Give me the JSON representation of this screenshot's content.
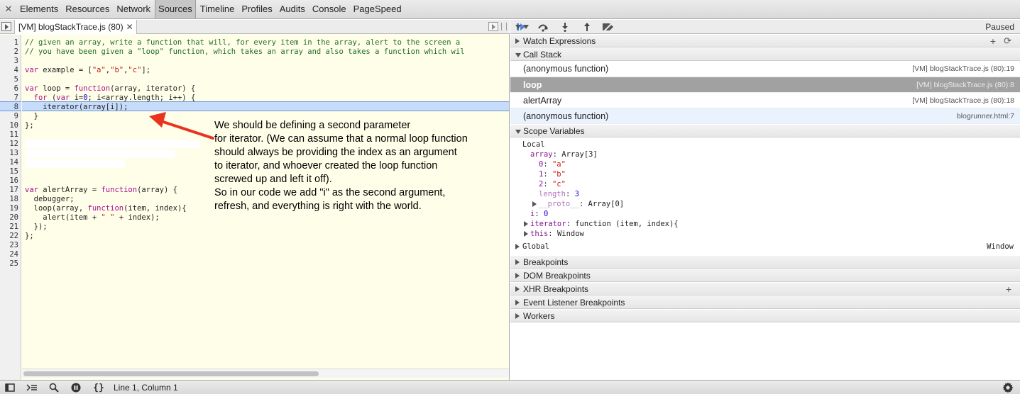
{
  "top_tabs": [
    {
      "label": "Elements"
    },
    {
      "label": "Resources"
    },
    {
      "label": "Network"
    },
    {
      "label": "Sources",
      "active": true
    },
    {
      "label": "Timeline"
    },
    {
      "label": "Profiles"
    },
    {
      "label": "Audits"
    },
    {
      "label": "Console"
    },
    {
      "label": "PageSpeed"
    }
  ],
  "file_tab": {
    "label": "[VM] blogStackTrace.js (80)"
  },
  "line_numbers": [
    "1",
    "2",
    "3",
    "4",
    "5",
    "6",
    "7",
    "8",
    "9",
    "10",
    "11",
    "12",
    "13",
    "14",
    "15",
    "16",
    "17",
    "18",
    "19",
    "20",
    "21",
    "22",
    "23",
    "24",
    "25"
  ],
  "code": {
    "line1": "// given an array, write a function that will, for every item in the array, alert to the screen a",
    "line2": "// you have been given a \"loop\" function, which takes an array and also takes a function which wil",
    "line4_kw": "var",
    "line4_a": " example = [",
    "line4_s1": "\"a\"",
    "line4_c1": ",",
    "line4_s2": "\"b\"",
    "line4_c2": ",",
    "line4_s3": "\"c\"",
    "line4_end": "];",
    "line6_kw": "var",
    "line6_a": " loop = ",
    "line6_kw2": "function",
    "line6_b": "(array, iterator) {",
    "line7_pre": "  ",
    "line7_kw": "for",
    "line7_a": " (",
    "line7_kw2": "var",
    "line7_b": " i=",
    "line7_n": "0",
    "line7_c": "; i<array.length; i++) {",
    "line8": "    iterator(array[i]);",
    "line9": "  }",
    "line10": "};",
    "line16_kw": "var",
    "line16_a": " alertArray = ",
    "line16_kw2": "function",
    "line16_b": "(array) {",
    "line17": "  debugger;",
    "line18_a": "  loop(array, ",
    "line18_kw": "function",
    "line18_b": "(item, index){",
    "line19_a": "    alert(item + ",
    "line19_s": "\" \"",
    "line19_b": " + index);",
    "line20": "  });",
    "line21": "};"
  },
  "annotation": "We should be defining a second parameter\nfor iterator. (We can assume that a normal loop function\nshould always be providing the index as an argument\nto iterator, and whoever created the loop function\nscrewed up and left it off).\nSo in our code we add \"i\" as the second argument,\nrefresh, and everything is right with the world.",
  "debugger": {
    "status": "Paused"
  },
  "sections": {
    "watch": "Watch Expressions",
    "callstack": "Call Stack",
    "scope": "Scope Variables",
    "breakpoints": "Breakpoints",
    "dom_breakpoints": "DOM Breakpoints",
    "xhr_breakpoints": "XHR Breakpoints",
    "event_breakpoints": "Event Listener Breakpoints",
    "workers": "Workers"
  },
  "call_stack": [
    {
      "name": "(anonymous function)",
      "loc": "[VM] blogStackTrace.js (80):19"
    },
    {
      "name": "loop",
      "loc": "[VM] blogStackTrace.js (80):8",
      "selected": true
    },
    {
      "name": "alertArray",
      "loc": "[VM] blogStackTrace.js (80):18"
    },
    {
      "name": "(anonymous function)",
      "loc": "blogrunner.html:7"
    }
  ],
  "scope": {
    "local_label": "Local",
    "array_key": "array",
    "array_val": ": Array[3]",
    "item0_key": "0",
    "item0_val": "\"a\"",
    "item1_key": "1",
    "item1_val": "\"b\"",
    "item2_key": "2",
    "item2_val": "\"c\"",
    "length_key": "length",
    "length_val": "3",
    "proto_key": "__proto__",
    "proto_val": ": Array[0]",
    "i_key": "i",
    "i_val": "0",
    "iterator_key": "iterator",
    "iterator_val": ": function (item, index){",
    "this_key": "this",
    "this_val": ": Window",
    "global_label": "Global",
    "global_val": "Window"
  },
  "status_bar": {
    "cursor": "Line 1, Column 1"
  },
  "colors": {
    "selected_row": "#a1a1a1",
    "highlight_line": "#c7dcfb",
    "editor_bg": "#fffee9",
    "arrow": "#e8341e"
  }
}
